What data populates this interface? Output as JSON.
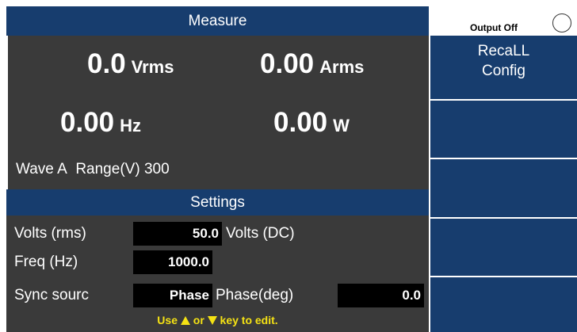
{
  "header": {
    "title": "Measure",
    "output_status": "Output Off"
  },
  "measurements": {
    "voltage": {
      "value": "0.0",
      "unit": "Vrms"
    },
    "current": {
      "value": "0.00",
      "unit": "Arms"
    },
    "frequency": {
      "value": "0.00",
      "unit": "Hz"
    },
    "power": {
      "value": "0.00",
      "unit": "W"
    }
  },
  "info_line": {
    "wave": "Wave A",
    "range_label": "Range(V)",
    "range_value": "300"
  },
  "settings": {
    "title": "Settings",
    "volts_rms": {
      "label": "Volts (rms)",
      "value": "50.0"
    },
    "volts_dc": {
      "label": "Volts (DC)"
    },
    "freq": {
      "label": "Freq (Hz)",
      "value": "1000.0"
    },
    "sync_source": {
      "label": "Sync sourc",
      "value": "Phase"
    },
    "phase": {
      "label": "Phase(deg)",
      "value": "0.0"
    },
    "hint": {
      "prefix": "Use",
      "middle": "or",
      "suffix": "key to edit."
    }
  },
  "softkeys": [
    {
      "line1": "RecaLL",
      "line2": "Config"
    },
    {
      "line1": "",
      "line2": ""
    },
    {
      "line1": "",
      "line2": ""
    },
    {
      "line1": "",
      "line2": ""
    },
    {
      "line1": "",
      "line2": ""
    }
  ],
  "colors": {
    "header_blue": "#173d6e",
    "panel_gray": "#3a3a3a",
    "hint_yellow": "#f5e214"
  }
}
